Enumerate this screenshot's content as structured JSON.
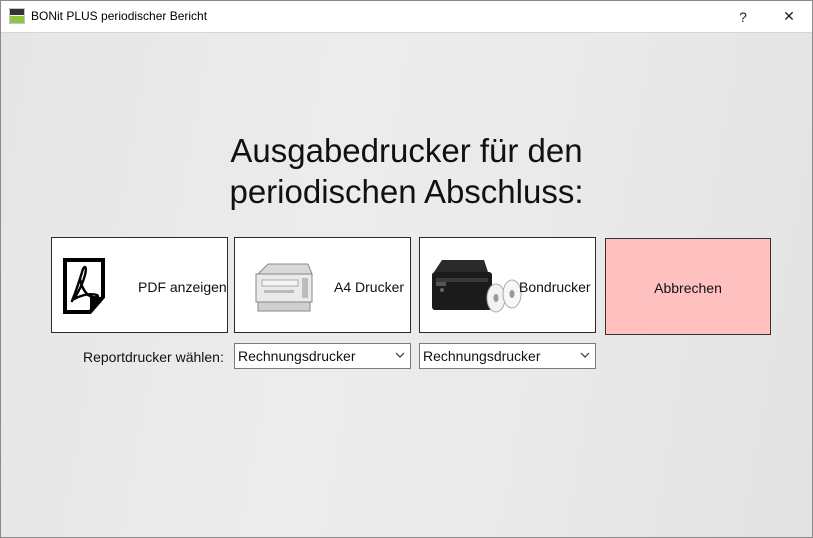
{
  "window": {
    "title": "BONit PLUS periodischer Bericht",
    "app_icon": "bonit-plus-logo"
  },
  "titlebar": {
    "help_label": "?",
    "close_label": "✕"
  },
  "heading": {
    "line1": "Ausgabedrucker für den",
    "line2": "periodischen Abschluss:"
  },
  "buttons": {
    "pdf": {
      "label": "PDF anzeigen",
      "icon": "pdf-document-icon"
    },
    "a4": {
      "label": "A4 Drucker",
      "icon": "laser-printer-image"
    },
    "bon": {
      "label": "Bondrucker",
      "icon": "receipt-printer-image"
    },
    "cancel": {
      "label": "Abbrechen",
      "color": "#ffc0c0"
    }
  },
  "report": {
    "label": "Reportdrucker wählen:",
    "a4_select": {
      "value": "Rechnungsdrucker"
    },
    "bon_select": {
      "value": "Rechnungsdrucker"
    }
  }
}
